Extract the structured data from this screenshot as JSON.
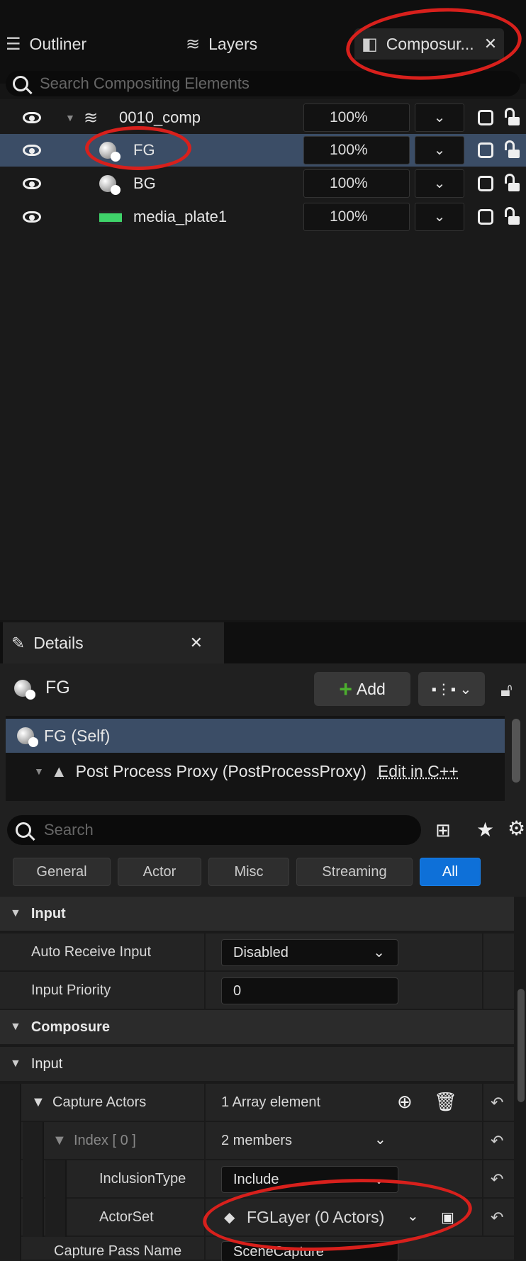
{
  "tabs": [
    {
      "label": "Outliner",
      "icon": "outliner-icon"
    },
    {
      "label": "Layers",
      "icon": "layers-icon"
    },
    {
      "label": "Composur...",
      "icon": "composure-icon",
      "active": true
    }
  ],
  "outliner": {
    "search_placeholder": "Search Compositing Elements",
    "rows": [
      {
        "name": "0010_comp",
        "opacity": "100%",
        "icon": "layers-icon"
      },
      {
        "name": "FG",
        "opacity": "100%",
        "icon": "sphere-icon",
        "selected": true
      },
      {
        "name": "BG",
        "opacity": "100%",
        "icon": "sphere-icon"
      },
      {
        "name": "media_plate1",
        "opacity": "100%",
        "icon": "media-plate-icon"
      }
    ]
  },
  "details": {
    "tab_label": "Details",
    "actor_name": "FG",
    "add_label": "Add",
    "components": [
      {
        "label": "FG (Self)"
      },
      {
        "label": "Post Process Proxy (PostProcessProxy)",
        "link": "Edit in C++"
      }
    ],
    "search_placeholder": "Search",
    "filters": [
      "General",
      "Actor",
      "Misc",
      "Streaming",
      "All"
    ],
    "active_filter": "All",
    "sections": {
      "input": "Input",
      "composure": "Composure",
      "composure_input": "Input"
    },
    "properties": {
      "auto_receive_input": {
        "label": "Auto Receive Input",
        "value": "Disabled"
      },
      "input_priority": {
        "label": "Input Priority",
        "value": "0"
      },
      "capture_actors": {
        "label": "Capture Actors",
        "value": "1 Array element"
      },
      "index0": {
        "label": "Index [ 0 ]",
        "value": "2 members"
      },
      "inclusion_type": {
        "label": "InclusionType",
        "value": "Include"
      },
      "actor_set": {
        "label": "ActorSet",
        "value": "FGLayer (0 Actors)"
      },
      "capture_pass_name": {
        "label": "Capture Pass Name",
        "value": "SceneCapture"
      }
    }
  },
  "colors": {
    "selection": "#3b4d66",
    "accent_blue": "#0e70d8",
    "add_green": "#4caf2e",
    "annotation_red": "#d8201c"
  }
}
